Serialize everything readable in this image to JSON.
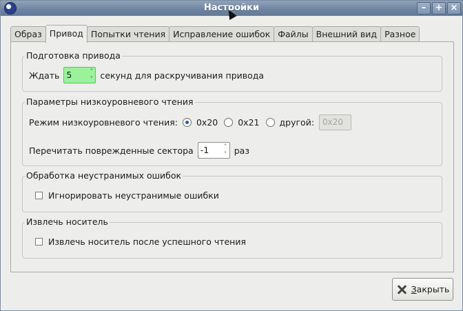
{
  "window": {
    "title": "Настройки",
    "buttons": [
      "–",
      "+",
      "×"
    ]
  },
  "tabs": [
    "Образ",
    "Привод",
    "Попытки чтения",
    "Исправление ошибок",
    "Файлы",
    "Внешний вид",
    "Разное"
  ],
  "active_tab": "Привод",
  "drive_prep": {
    "title": "Подготовка привода",
    "wait_label": "Ждать",
    "wait_value": "5",
    "wait_suffix": "секунд для раскручивания привода"
  },
  "low_level": {
    "title": "Параметры низкоуровневого чтения",
    "mode_label": "Режим низкоуровневого чтения:",
    "options": [
      "0x20",
      "0x21",
      "другой:"
    ],
    "selected": "0x20",
    "other_value": "0x20",
    "reread_label": "Перечитать поврежденные сектора",
    "reread_value": "-1",
    "reread_suffix": "раз"
  },
  "unrecoverable": {
    "title": "Обработка неустранимых ошибок",
    "ignore_label": "Игнорировать неустранимые ошибки",
    "checked": false
  },
  "eject": {
    "title": "Извлечь носитель",
    "eject_label": "Извлечь носитель после успешного чтения",
    "checked": false
  },
  "close_button": {
    "mnemonic": "З",
    "rest": "акрыть"
  }
}
